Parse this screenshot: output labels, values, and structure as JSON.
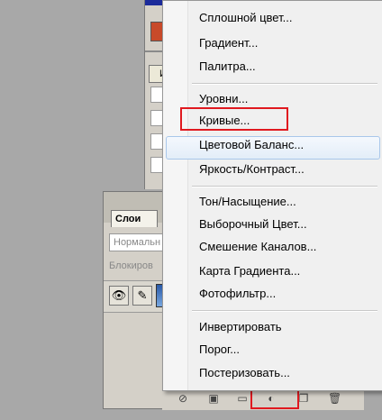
{
  "menu": {
    "group1": [
      "Сплошной цвет...",
      "Градиент...",
      "Палитра..."
    ],
    "group2": [
      "Уровни...",
      "Кривые...",
      "Цветовой Баланс...",
      "Яркость/Контраст..."
    ],
    "group3": [
      "Тон/Насыщение...",
      "Выборочный Цвет...",
      "Смешение Каналов...",
      "Карта Градиента...",
      "Фотофильтр..."
    ],
    "group4": [
      "Инвертировать",
      "Порог...",
      "Постеризовать..."
    ],
    "hovered_item": "Цветовой Баланс...",
    "highlighted_item": "Кривые..."
  },
  "layers_panel": {
    "tab_label": "Слои",
    "blend_mode": "Нормальн",
    "lock_label": "Блокиров"
  },
  "top_panel": {
    "tab_label": "И"
  },
  "colors": {
    "highlight_border": "#e0191f",
    "hover_border": "#a9c7ea"
  }
}
